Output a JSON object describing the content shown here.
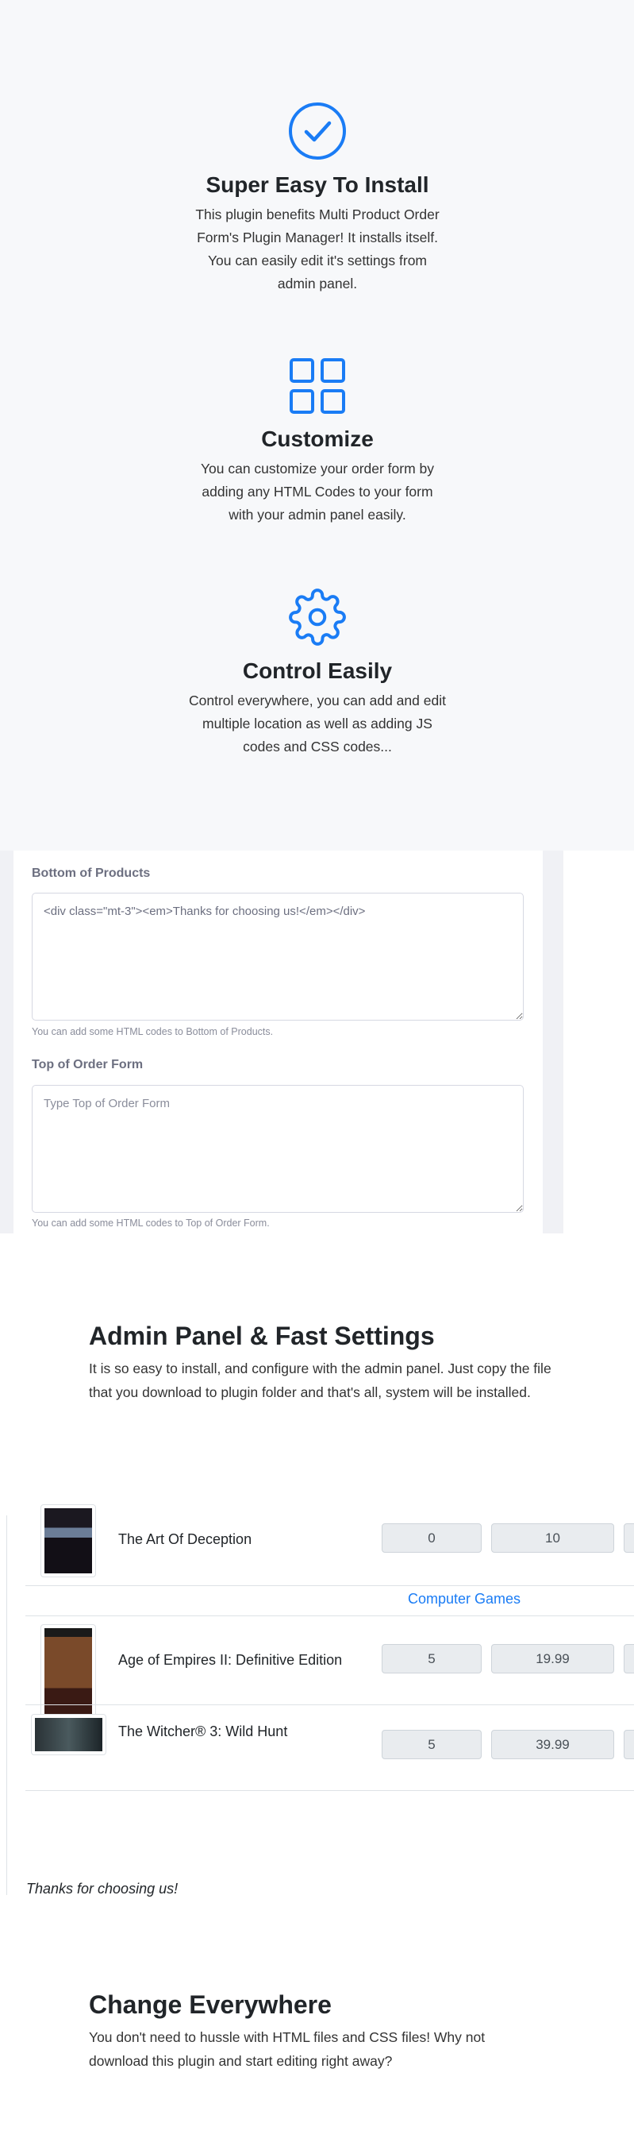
{
  "colors": {
    "accent": "#1a7cf5",
    "background": "#f7f8fa"
  },
  "features": [
    {
      "icon": "check-circle-icon",
      "title": "Super Easy To Install",
      "text": "This plugin benefits Multi Product Order Form's Plugin Manager! It installs itself. You can easily edit it's settings from admin panel."
    },
    {
      "icon": "grid-icon",
      "title": "Customize",
      "text": "You can customize your order form by adding any HTML Codes to your form with your admin panel easily."
    },
    {
      "icon": "gear-icon",
      "title": "Control Easily",
      "text": "Control everywhere, you can add and edit multiple location as well as adding JS codes and CSS codes..."
    }
  ],
  "settings": {
    "bottom_label": "Bottom of Products",
    "bottom_value": "<div class=\"mt-3\"><em>Thanks for choosing us!</em></div>",
    "bottom_help": "You can add some HTML codes to Bottom of Products.",
    "top_label": "Top of Order Form",
    "top_placeholder": "Type Top of Order Form",
    "top_help": "You can add some HTML codes to Top of Order Form."
  },
  "admin": {
    "title": "Admin Panel & Fast Settings",
    "text": "It is so easy to install, and configure with the admin panel. Just copy the file that you download to plugin folder and that's all, system will be installed."
  },
  "products": {
    "rows": [
      {
        "name": "The Art Of Deception",
        "qty": "0",
        "price": "10"
      },
      {
        "name": "Age of Empires II: Definitive Edition",
        "qty": "5",
        "price": "19.99"
      },
      {
        "name": "The Witcher® 3: Wild Hunt",
        "qty": "5",
        "price": "39.99"
      }
    ],
    "category": "Computer Games",
    "footer": "Thanks for choosing us!"
  },
  "change": {
    "title": "Change Everywhere",
    "text": "You don't need to hussle with HTML files and CSS files! Why not download this plugin and start editing right away?"
  }
}
